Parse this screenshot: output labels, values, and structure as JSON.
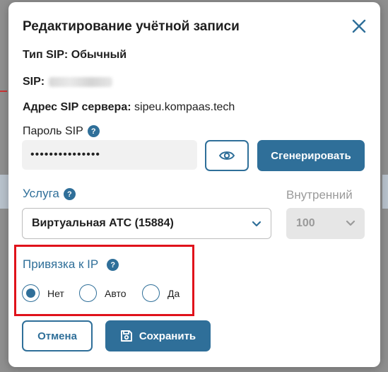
{
  "modal": {
    "title": "Редактирование учётной записи",
    "sip_type_label": "Тип SIP:",
    "sip_type_value": "Обычный",
    "sip_label": "SIP:",
    "server_label": "Адрес SIP сервера:",
    "server_value": "sipeu.kompaas.tech",
    "password_label": "Пароль SIP",
    "password_value": "•••••••••••••••",
    "generate_button": "Сгенерировать",
    "service_label": "Услуга",
    "service_value": "Виртуальная АТС (15884)",
    "internal_label": "Внутренний",
    "internal_value": "100",
    "ip_binding_label": "Привязка к IP",
    "ip_options": [
      "Нет",
      "Авто",
      "Да"
    ],
    "ip_selected": "Нет",
    "help_glyph": "?",
    "cancel_button": "Отмена",
    "save_button": "Сохранить"
  },
  "colors": {
    "accent": "#2f6f99",
    "highlight": "#e0121b"
  }
}
